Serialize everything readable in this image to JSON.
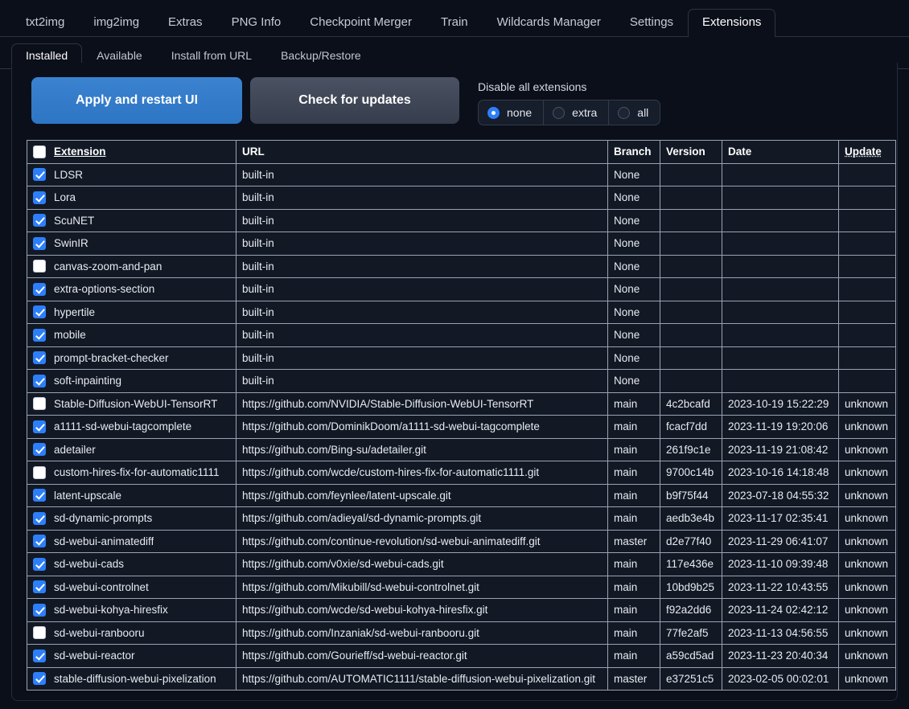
{
  "topnav": {
    "tabs": [
      {
        "label": "txt2img",
        "active": false
      },
      {
        "label": "img2img",
        "active": false
      },
      {
        "label": "Extras",
        "active": false
      },
      {
        "label": "PNG Info",
        "active": false
      },
      {
        "label": "Checkpoint Merger",
        "active": false
      },
      {
        "label": "Train",
        "active": false
      },
      {
        "label": "Wildcards Manager",
        "active": false
      },
      {
        "label": "Settings",
        "active": false
      },
      {
        "label": "Extensions",
        "active": true
      }
    ]
  },
  "subnav": {
    "tabs": [
      {
        "label": "Installed",
        "active": true
      },
      {
        "label": "Available",
        "active": false
      },
      {
        "label": "Install from URL",
        "active": false
      },
      {
        "label": "Backup/Restore",
        "active": false
      }
    ]
  },
  "toolbar": {
    "apply_label": "Apply and restart UI",
    "check_label": "Check for updates",
    "disable_label": "Disable all extensions",
    "radio_options": [
      {
        "label": "none",
        "checked": true
      },
      {
        "label": "extra",
        "checked": false
      },
      {
        "label": "all",
        "checked": false
      }
    ],
    "colors": {
      "primary": "#2d76c4",
      "secondary": "#3f4757",
      "accent": "#2d7ff9"
    }
  },
  "table": {
    "headers": {
      "select_all_checked": false,
      "extension": "Extension",
      "url": "URL",
      "branch": "Branch",
      "version": "Version",
      "date": "Date",
      "update": "Update"
    },
    "rows": [
      {
        "checked": true,
        "name": "LDSR",
        "url": "built-in",
        "branch": "None",
        "version": "",
        "date": "",
        "update": ""
      },
      {
        "checked": true,
        "name": "Lora",
        "url": "built-in",
        "branch": "None",
        "version": "",
        "date": "",
        "update": ""
      },
      {
        "checked": true,
        "name": "ScuNET",
        "url": "built-in",
        "branch": "None",
        "version": "",
        "date": "",
        "update": ""
      },
      {
        "checked": true,
        "name": "SwinIR",
        "url": "built-in",
        "branch": "None",
        "version": "",
        "date": "",
        "update": ""
      },
      {
        "checked": false,
        "name": "canvas-zoom-and-pan",
        "url": "built-in",
        "branch": "None",
        "version": "",
        "date": "",
        "update": ""
      },
      {
        "checked": true,
        "name": "extra-options-section",
        "url": "built-in",
        "branch": "None",
        "version": "",
        "date": "",
        "update": ""
      },
      {
        "checked": true,
        "name": "hypertile",
        "url": "built-in",
        "branch": "None",
        "version": "",
        "date": "",
        "update": ""
      },
      {
        "checked": true,
        "name": "mobile",
        "url": "built-in",
        "branch": "None",
        "version": "",
        "date": "",
        "update": ""
      },
      {
        "checked": true,
        "name": "prompt-bracket-checker",
        "url": "built-in",
        "branch": "None",
        "version": "",
        "date": "",
        "update": ""
      },
      {
        "checked": true,
        "name": "soft-inpainting",
        "url": "built-in",
        "branch": "None",
        "version": "",
        "date": "",
        "update": ""
      },
      {
        "checked": false,
        "name": "Stable-Diffusion-WebUI-TensorRT",
        "url": "https://github.com/NVIDIA/Stable-Diffusion-WebUI-TensorRT",
        "branch": "main",
        "version": "4c2bcafd",
        "date": "2023-10-19 15:22:29",
        "update": "unknown"
      },
      {
        "checked": true,
        "name": "a1111-sd-webui-tagcomplete",
        "url": "https://github.com/DominikDoom/a1111-sd-webui-tagcomplete",
        "branch": "main",
        "version": "fcacf7dd",
        "date": "2023-11-19 19:20:06",
        "update": "unknown"
      },
      {
        "checked": true,
        "name": "adetailer",
        "url": "https://github.com/Bing-su/adetailer.git",
        "branch": "main",
        "version": "261f9c1e",
        "date": "2023-11-19 21:08:42",
        "update": "unknown"
      },
      {
        "checked": false,
        "name": "custom-hires-fix-for-automatic1111",
        "url": "https://github.com/wcde/custom-hires-fix-for-automatic1111.git",
        "branch": "main",
        "version": "9700c14b",
        "date": "2023-10-16 14:18:48",
        "update": "unknown"
      },
      {
        "checked": true,
        "name": "latent-upscale",
        "url": "https://github.com/feynlee/latent-upscale.git",
        "branch": "main",
        "version": "b9f75f44",
        "date": "2023-07-18 04:55:32",
        "update": "unknown"
      },
      {
        "checked": true,
        "name": "sd-dynamic-prompts",
        "url": "https://github.com/adieyal/sd-dynamic-prompts.git",
        "branch": "main",
        "version": "aedb3e4b",
        "date": "2023-11-17 02:35:41",
        "update": "unknown"
      },
      {
        "checked": true,
        "name": "sd-webui-animatediff",
        "url": "https://github.com/continue-revolution/sd-webui-animatediff.git",
        "branch": "master",
        "version": "d2e77f40",
        "date": "2023-11-29 06:41:07",
        "update": "unknown"
      },
      {
        "checked": true,
        "name": "sd-webui-cads",
        "url": "https://github.com/v0xie/sd-webui-cads.git",
        "branch": "main",
        "version": "117e436e",
        "date": "2023-11-10 09:39:48",
        "update": "unknown"
      },
      {
        "checked": true,
        "name": "sd-webui-controlnet",
        "url": "https://github.com/Mikubill/sd-webui-controlnet.git",
        "branch": "main",
        "version": "10bd9b25",
        "date": "2023-11-22 10:43:55",
        "update": "unknown"
      },
      {
        "checked": true,
        "name": "sd-webui-kohya-hiresfix",
        "url": "https://github.com/wcde/sd-webui-kohya-hiresfix.git",
        "branch": "main",
        "version": "f92a2dd6",
        "date": "2023-11-24 02:42:12",
        "update": "unknown"
      },
      {
        "checked": false,
        "name": "sd-webui-ranbooru",
        "url": "https://github.com/Inzaniak/sd-webui-ranbooru.git",
        "branch": "main",
        "version": "77fe2af5",
        "date": "2023-11-13 04:56:55",
        "update": "unknown"
      },
      {
        "checked": true,
        "name": "sd-webui-reactor",
        "url": "https://github.com/Gourieff/sd-webui-reactor.git",
        "branch": "main",
        "version": "a59cd5ad",
        "date": "2023-11-23 20:40:34",
        "update": "unknown"
      },
      {
        "checked": true,
        "name": "stable-diffusion-webui-pixelization",
        "url": "https://github.com/AUTOMATIC1111/stable-diffusion-webui-pixelization.git",
        "branch": "master",
        "version": "e37251c5",
        "date": "2023-02-05 00:02:01",
        "update": "unknown"
      }
    ]
  }
}
